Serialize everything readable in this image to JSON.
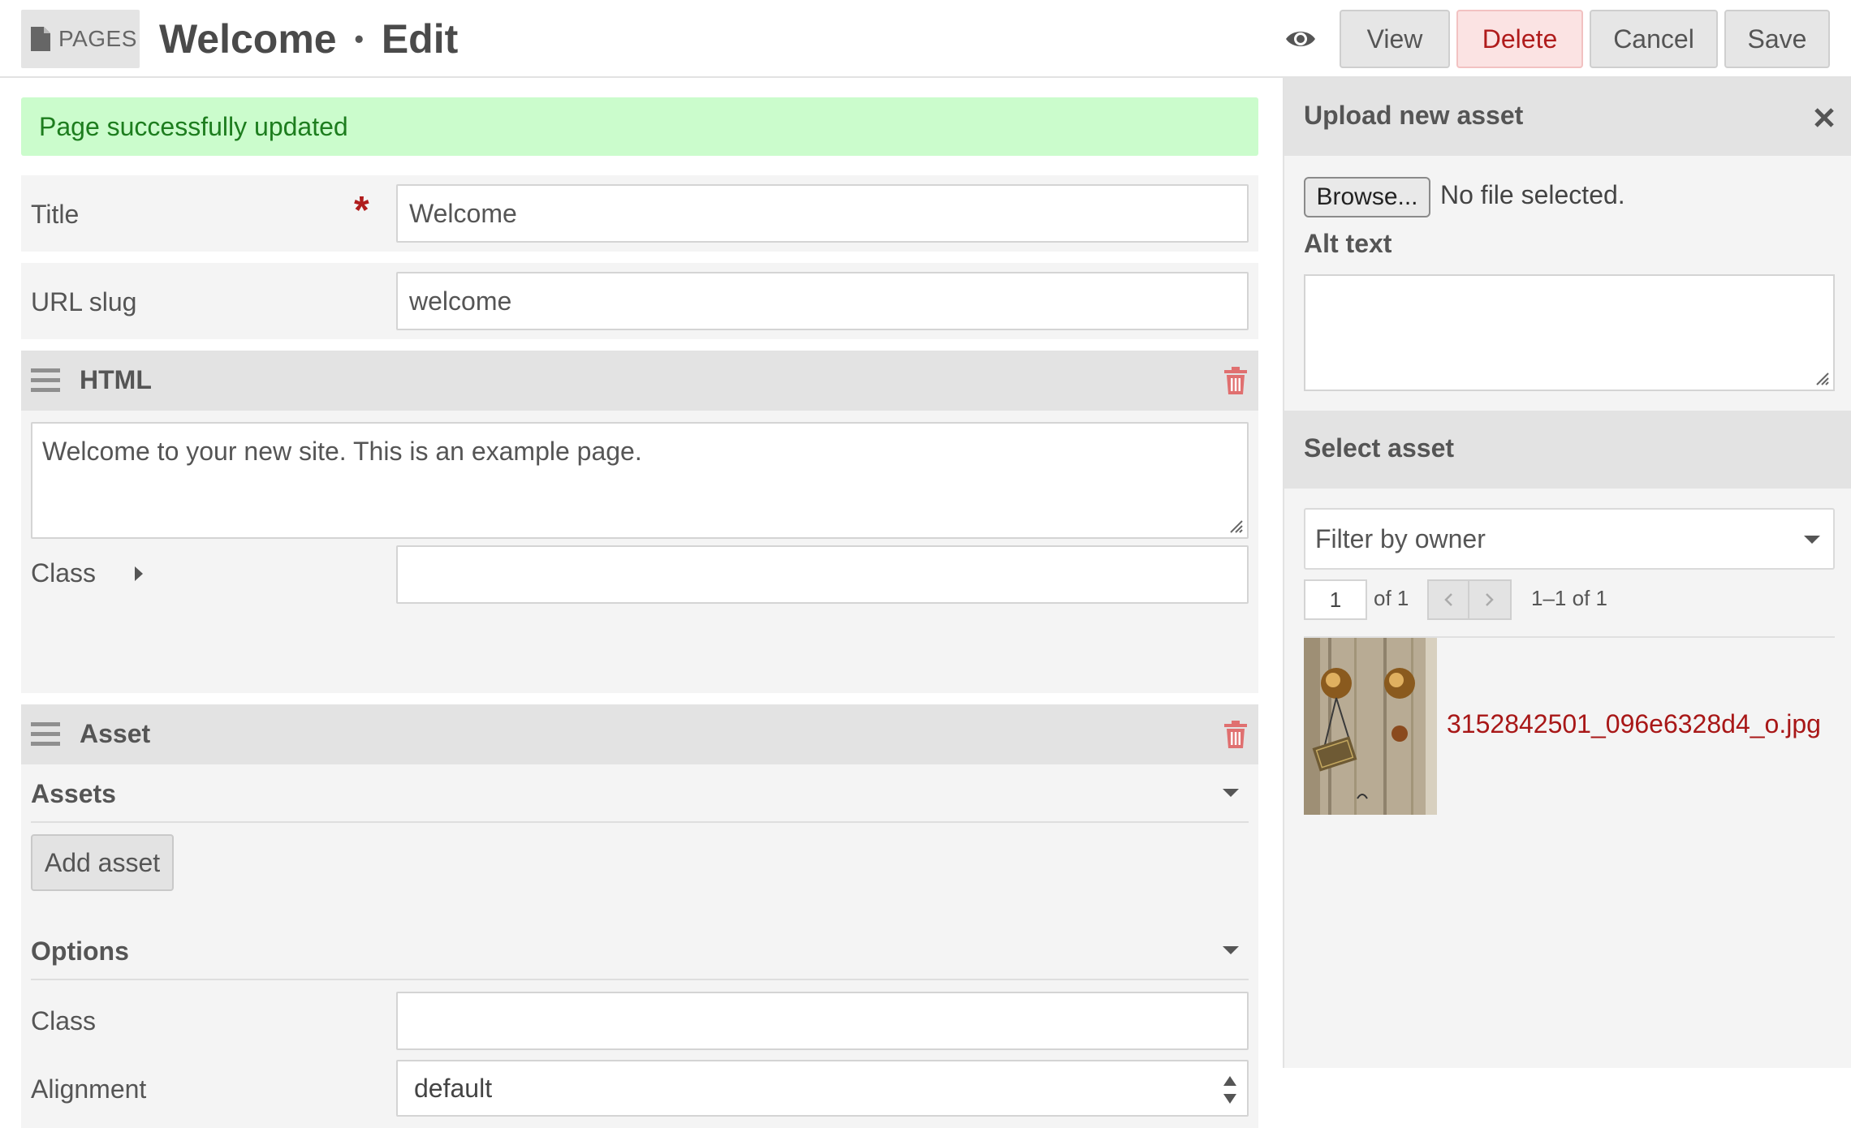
{
  "header": {
    "section_label": "PAGES",
    "title": "Welcome",
    "separator": "•",
    "mode": "Edit",
    "buttons": {
      "view": "View",
      "delete": "Delete",
      "cancel": "Cancel",
      "save": "Save"
    },
    "icons": {
      "section": "document-icon",
      "preview": "eye-icon"
    }
  },
  "flash": {
    "message": "Page successfully updated",
    "color": "#1d7d1e",
    "background": "#cbfccc"
  },
  "form": {
    "title": {
      "label": "Title",
      "required_mark": "*",
      "value": "Welcome"
    },
    "slug": {
      "label": "URL slug",
      "value": "welcome"
    },
    "html_block": {
      "title": "HTML",
      "content": "Welcome to your new site. This is an example page.",
      "class_label": "Class",
      "class_value": ""
    },
    "asset_block": {
      "title": "Asset",
      "assets_label": "Assets",
      "add_asset_label": "Add asset",
      "options_label": "Options",
      "class_label": "Class",
      "class_value": "",
      "alignment_label": "Alignment",
      "alignment_value": "default"
    }
  },
  "sidebar": {
    "upload": {
      "title": "Upload new asset",
      "browse_label": "Browse...",
      "no_file_text": "No file selected.",
      "alt_label": "Alt text",
      "alt_value": ""
    },
    "select": {
      "title": "Select asset",
      "filter_placeholder": "Filter by owner",
      "page": "1",
      "of_total": "of 1",
      "range": "1–1 of 1",
      "assets": [
        {
          "filename": "3152842501_096e6328d4_o.jpg"
        }
      ]
    }
  },
  "colors": {
    "danger": "#b01c1c",
    "link": "#a81717",
    "panel": "#f4f4f4",
    "panel_header": "#e3e3e3"
  }
}
